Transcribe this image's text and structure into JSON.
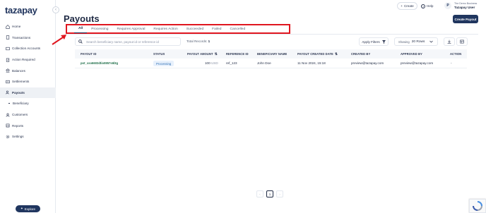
{
  "sidebar": {
    "logo": "tazapay",
    "collapse_icon": "chevron-left-icon",
    "items": [
      {
        "label": "Home",
        "icon": "home-icon"
      },
      {
        "label": "Transactions",
        "icon": "document-icon"
      },
      {
        "label": "Collection Accounts",
        "icon": "wallet-icon"
      },
      {
        "label": "Action Required",
        "icon": "clipboard-icon"
      },
      {
        "label": "Balances",
        "icon": "bank-icon"
      },
      {
        "label": "Settlements",
        "icon": "settlement-icon"
      },
      {
        "label": "Payouts",
        "icon": "payout-icon"
      },
      {
        "label": "Beneficiary",
        "icon": "dash"
      },
      {
        "label": "Customers",
        "icon": "user-icon"
      },
      {
        "label": "Reports",
        "icon": "report-icon"
      },
      {
        "label": "Settings",
        "icon": "gear-icon"
      }
    ],
    "active_index": 6,
    "explore_label": "Explore"
  },
  "header": {
    "create_label": "Create",
    "help_label": "Help",
    "avatar_initial": "P",
    "business_name": "The Demo Business",
    "user_name": "Tazapay User"
  },
  "page": {
    "title": "Payouts",
    "create_button": "Create Payout"
  },
  "tabs": [
    "All",
    "Processing",
    "Requires Approval",
    "Requires Action",
    "Succeeded",
    "Failed",
    "Cancelled"
  ],
  "active_tab": 0,
  "search": {
    "placeholder": "Search beneficiary name, payout id or reference id",
    "value": ""
  },
  "total_records_label": "Total Records:",
  "total_records": "1",
  "apply_filters_label": "Apply Filters",
  "showing_label": "Showing",
  "rows_per_page": "20 Rows",
  "table": {
    "columns": [
      "PAYOUT ID",
      "STATUS",
      "PAYOUT AMOUNT",
      "REFERENCE ID",
      "BENEFICIARY NAME",
      "PAYOUT CREATED DATE",
      "CREATED BY",
      "APPROVED BY",
      "ACTION"
    ],
    "rows": [
      {
        "payout_id": "pot_cso6603dtio0857s6l3g",
        "status": "Processing",
        "amount": "100",
        "currency": "USD",
        "reference_id": "ref_123",
        "beneficiary": "John Doe",
        "created_date": "11 Nov 2024, 15:18",
        "created_by": "preview@tazapay.com",
        "approved_by": "preview@tazapay.com",
        "action": "-"
      }
    ]
  },
  "pagination": {
    "prev": "‹",
    "current": "1",
    "next": "›"
  },
  "colors": {
    "accent": "#20365f",
    "highlight": "#e0161f",
    "status_processing": "#2f6fb4"
  }
}
